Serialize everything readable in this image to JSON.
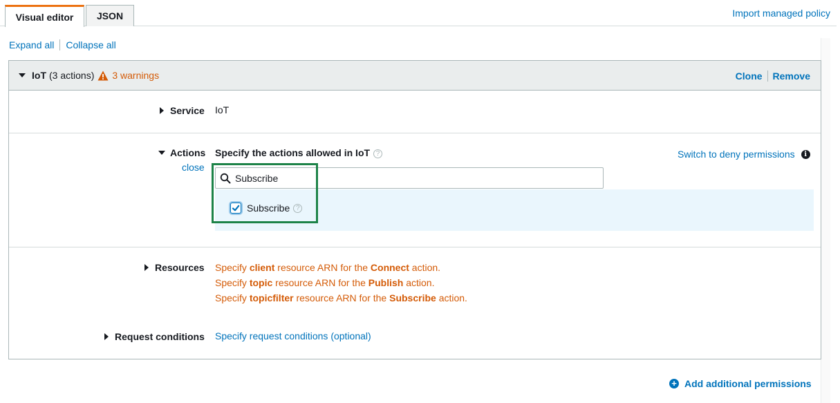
{
  "tabs": [
    {
      "label": "Visual editor",
      "active": true
    },
    {
      "label": "JSON",
      "active": false
    }
  ],
  "import_link": "Import managed policy",
  "expand_all": "Expand all",
  "collapse_all": "Collapse all",
  "panel": {
    "service_name": "IoT",
    "actions_count": "(3 actions)",
    "warnings": "3 warnings",
    "clone": "Clone",
    "remove": "Remove"
  },
  "service_row": {
    "label": "Service",
    "value": "IoT"
  },
  "actions_row": {
    "label": "Actions",
    "close": "close",
    "heading": "Specify the actions allowed in IoT",
    "switch_deny": "Switch to deny permissions",
    "search_value": "Subscribe",
    "checkbox_label": "Subscribe",
    "checked": true
  },
  "resources_row": {
    "label": "Resources",
    "lines": [
      {
        "pre": "Specify ",
        "res": "client",
        "mid": " resource ARN for the ",
        "act": "Connect",
        "post": " action."
      },
      {
        "pre": "Specify ",
        "res": "topic",
        "mid": " resource ARN for the ",
        "act": "Publish",
        "post": " action."
      },
      {
        "pre": "Specify ",
        "res": "topicfilter",
        "mid": " resource ARN for the ",
        "act": "Subscribe",
        "post": " action."
      }
    ]
  },
  "conditions_row": {
    "label": "Request conditions",
    "link": "Specify request conditions (optional)"
  },
  "add_permissions": "Add additional permissions",
  "colors": {
    "link": "#0073bb",
    "warning": "#d45b07",
    "highlight": "#1d8348",
    "tab_accent": "#ec7211"
  }
}
